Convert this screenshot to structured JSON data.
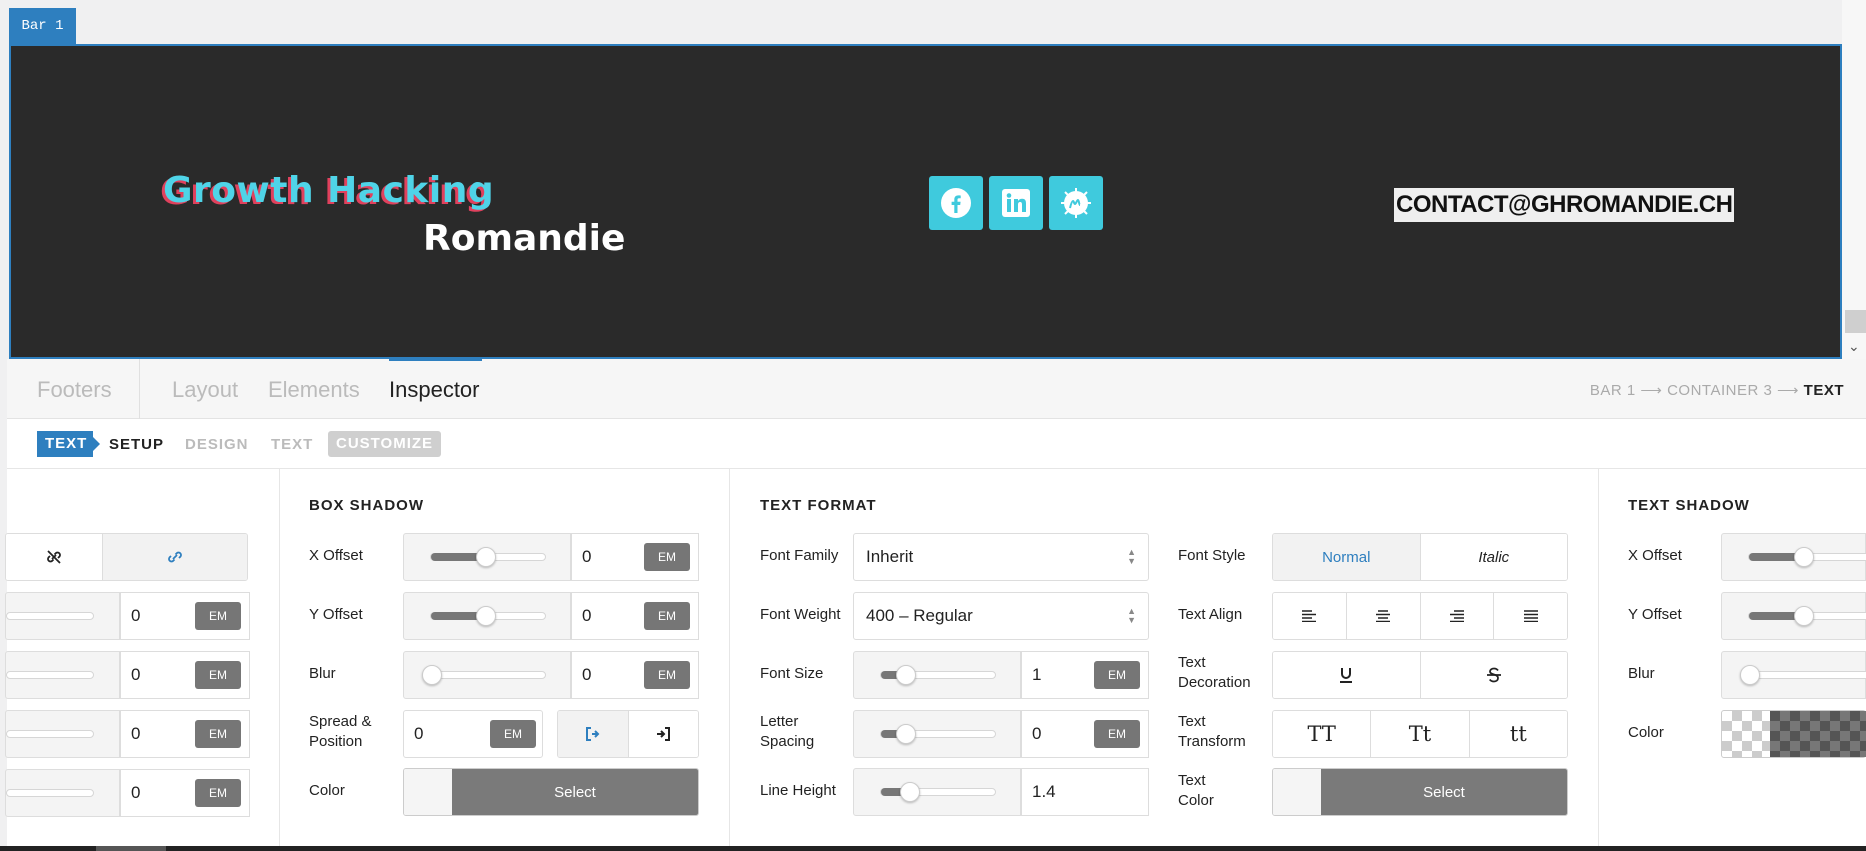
{
  "preview": {
    "bar_tab": "Bar 1",
    "logo_line1": "Growth Hacking",
    "logo_line2": "Romandie",
    "email": "CONTACT@GHROMANDIE.CH",
    "socials": [
      "facebook-icon",
      "linkedin-icon",
      "malt-icon"
    ]
  },
  "nav": {
    "footers": "Footers",
    "layout": "Layout",
    "elements": "Elements",
    "inspector": "Inspector",
    "breadcrumb_1": "BAR 1",
    "breadcrumb_2": "CONTAINER 3",
    "breadcrumb_3": "TEXT",
    "arrow": "⟶"
  },
  "subnav": {
    "tag": "TEXT",
    "setup": "SETUP",
    "design": "DESIGN",
    "text": "TEXT",
    "customize": "CUSTOMIZE"
  },
  "left_col": {
    "values": [
      "0",
      "0",
      "0",
      "0"
    ],
    "unit": "EM"
  },
  "box_shadow": {
    "title": "BOX SHADOW",
    "x_offset_label": "X Offset",
    "x_offset": "0",
    "y_offset_label": "Y Offset",
    "y_offset": "0",
    "blur_label": "Blur",
    "blur": "0",
    "spread_label": "Spread & Position",
    "spread": "0",
    "color_label": "Color",
    "select": "Select",
    "unit": "EM"
  },
  "text_format": {
    "title": "TEXT FORMAT",
    "font_family_label": "Font Family",
    "font_family": "Inherit",
    "font_weight_label": "Font Weight",
    "font_weight": "400 – Regular",
    "font_size_label": "Font Size",
    "font_size": "1",
    "letter_spacing_label": "Letter Spacing",
    "letter_spacing": "0",
    "line_height_label": "Line Height",
    "line_height": "1.4",
    "font_style_label": "Font Style",
    "font_style_normal": "Normal",
    "font_style_italic": "Italic",
    "text_align_label": "Text Align",
    "text_decoration_label": "Text Decoration",
    "text_transform_label": "Text Transform",
    "transform_upper": "TT",
    "transform_cap": "Tt",
    "transform_lower": "tt",
    "text_color_label": "Text Color",
    "select": "Select",
    "unit": "EM"
  },
  "text_shadow": {
    "title": "TEXT SHADOW",
    "x_offset_label": "X Offset",
    "y_offset_label": "Y Offset",
    "blur_label": "Blur",
    "color_label": "Color"
  }
}
